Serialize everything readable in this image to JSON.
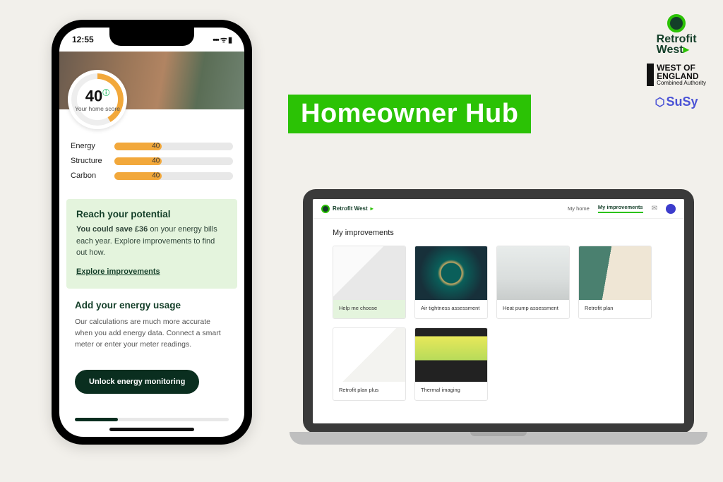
{
  "headline": "Homeowner Hub",
  "logos": {
    "retrofit": {
      "line1": "Retrofit",
      "line2": "West"
    },
    "woe": {
      "line1": "WEST OF",
      "line2": "ENGLAND",
      "sub": "Combined Authority"
    },
    "susy": "SuSy"
  },
  "phone": {
    "time": "12:55",
    "score_value": "40",
    "score_label": "Your home score",
    "bars": [
      {
        "label": "Energy",
        "value": "40"
      },
      {
        "label": "Structure",
        "value": "40"
      },
      {
        "label": "Carbon",
        "value": "40"
      }
    ],
    "potential": {
      "title": "Reach your potential",
      "body_bold": "You could save £36",
      "body_rest": " on your energy bills each year. Explore improvements to find out how.",
      "link": "Explore improvements"
    },
    "usage": {
      "title": "Add your energy usage",
      "body": "Our calculations are much more accurate when you add energy data. Connect a smart meter or enter your meter readings.",
      "button": "Unlock energy monitoring"
    }
  },
  "laptop": {
    "logo": "Retrofit West",
    "nav": {
      "home": "My home",
      "improvements": "My improvements"
    },
    "page_title": "My improvements",
    "cards": [
      {
        "label": "Help me choose",
        "highlight": true
      },
      {
        "label": "Air tightness assessment"
      },
      {
        "label": "Heat pump assessment"
      },
      {
        "label": "Retrofit plan"
      },
      {
        "label": "Retrofit plan plus"
      },
      {
        "label": "Thermal imaging"
      }
    ]
  }
}
